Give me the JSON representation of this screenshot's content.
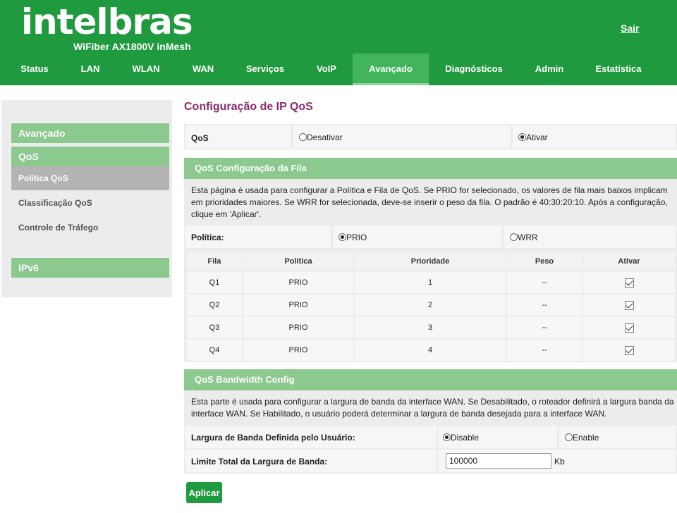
{
  "brand": {
    "logo": "intelbras",
    "model": "WiFiber AX1800V inMesh",
    "logout": "Sair",
    "color": "#1f9a3e"
  },
  "nav": [
    "Status",
    "LAN",
    "WLAN",
    "WAN",
    "Serviços",
    "VoIP",
    "Avançado",
    "Diagnósticos",
    "Admin",
    "Estatística"
  ],
  "nav_active": "Avançado",
  "sidebar": {
    "section": "Avançado",
    "group": "QoS",
    "items": [
      "Política QoS",
      "Classificação QoS",
      "Controle de Tráfego"
    ],
    "active_item": "Política QoS",
    "section2": "IPv6"
  },
  "page_title": "Configuração de IP QoS",
  "qos": {
    "label": "QoS",
    "opt_disable": "Desativar",
    "opt_enable": "Ativar",
    "selected": "Ativar"
  },
  "queue": {
    "title": "QoS Configuração da Fila",
    "description": "Esta página é usada para configurar a Política e Fila de QoS. Se PRIO for selecionado, os valores de fila mais baixos implicam em prioridades maiores. Se WRR for selecionada, deve-se inserir o peso da fila. O padrão é 40:30:20:10. Após a configuração, clique em 'Aplicar'.",
    "policy_label": "Política:",
    "opt_prio": "PRIO",
    "opt_wrr": "WRR",
    "selected": "PRIO",
    "columns": [
      "Fila",
      "Política",
      "Prioridade",
      "Peso",
      "Ativar"
    ],
    "rows": [
      {
        "fila": "Q1",
        "politica": "PRIO",
        "prioridade": "1",
        "peso": "--",
        "ativar": true
      },
      {
        "fila": "Q2",
        "politica": "PRIO",
        "prioridade": "2",
        "peso": "--",
        "ativar": true
      },
      {
        "fila": "Q3",
        "politica": "PRIO",
        "prioridade": "3",
        "peso": "--",
        "ativar": true
      },
      {
        "fila": "Q4",
        "politica": "PRIO",
        "prioridade": "4",
        "peso": "--",
        "ativar": true
      }
    ]
  },
  "bandwidth": {
    "title": "QoS Bandwidth Config",
    "description": "Esta parte é usada para configurar a largura de banda da interface WAN. Se Desabilitado, o roteador definirá a largura banda da interface WAN. Se Habilitado, o usuário poderá determinar a largura de banda desejada para a interface WAN.",
    "user_defined_label": "Largura de Banda Definida pelo Usuário:",
    "opt_disable": "Disable",
    "opt_enable": "Enable",
    "selected": "Disable",
    "limit_label": "Limite Total da Largura de Banda:",
    "limit_value": "100000",
    "unit": "Kb"
  },
  "apply_label": "Aplicar"
}
